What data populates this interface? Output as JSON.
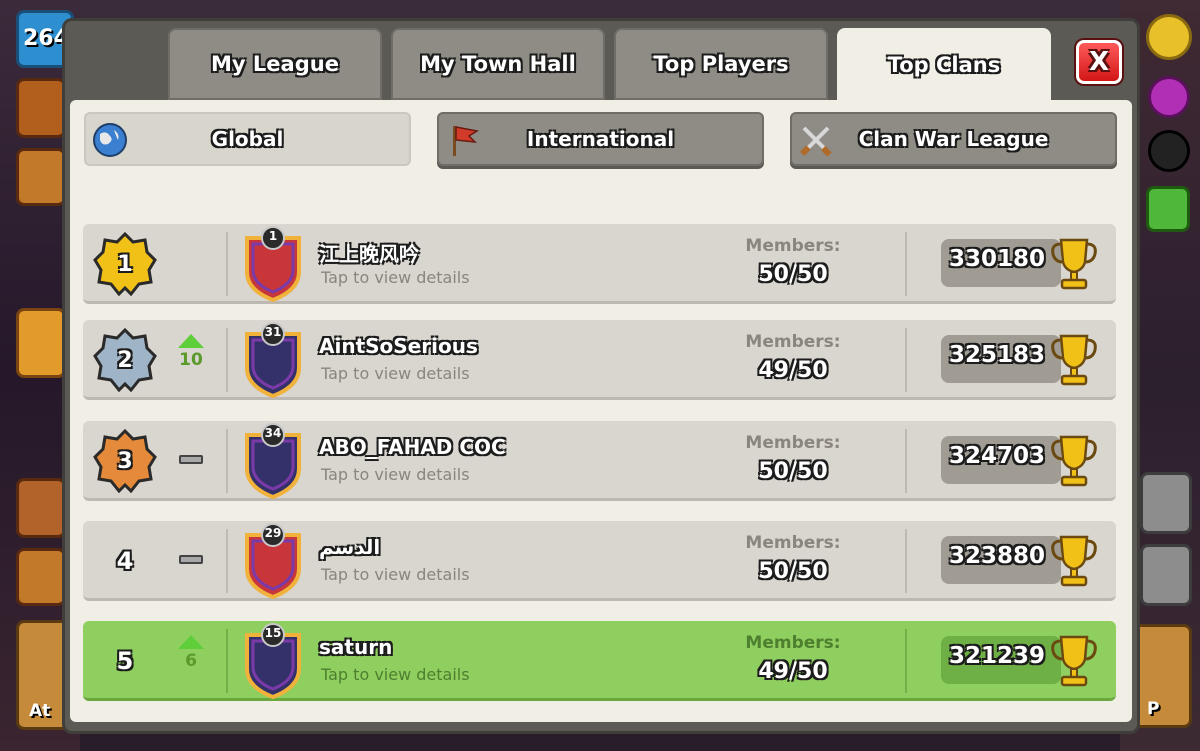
{
  "hud": {
    "level": "264",
    "left_bottom_label": "At",
    "right_bottom_label": "P"
  },
  "tabs": [
    {
      "label": "My League",
      "active": false
    },
    {
      "label": "My Town Hall",
      "active": false
    },
    {
      "label": "Top Players",
      "active": false
    },
    {
      "label": "Top Clans",
      "active": true
    }
  ],
  "close_label": "X",
  "filters": [
    {
      "label": "Global",
      "icon": "globe-icon",
      "selected": true
    },
    {
      "label": "International",
      "icon": "flag-icon",
      "selected": false
    },
    {
      "label": "Clan War League",
      "icon": "crossed-swords-icon",
      "selected": false
    }
  ],
  "members_label": "Members:",
  "tap_label": "Tap to view details",
  "clans": [
    {
      "rank": "1",
      "rank_style": "gold",
      "change": "",
      "change_type": "none",
      "badge_level": "1",
      "badge_color": "#c8363a",
      "name": "江上晚风吟",
      "members": "50/50",
      "trophies": "330180",
      "highlight": false
    },
    {
      "rank": "2",
      "rank_style": "silver",
      "change": "10",
      "change_type": "up",
      "badge_level": "31",
      "badge_color": "#34306a",
      "name": "AintSoSerious",
      "members": "49/50",
      "trophies": "325183",
      "highlight": false
    },
    {
      "rank": "3",
      "rank_style": "bronze",
      "change": "",
      "change_type": "same",
      "badge_level": "34",
      "badge_color": "#34306a",
      "name": "ABO_FAHAD COC",
      "members": "50/50",
      "trophies": "324703",
      "highlight": false
    },
    {
      "rank": "4",
      "rank_style": "plain",
      "change": "",
      "change_type": "same",
      "badge_level": "29",
      "badge_color": "#c8363a",
      "name": "الدسم",
      "members": "50/50",
      "trophies": "323880",
      "highlight": false
    },
    {
      "rank": "5",
      "rank_style": "plain",
      "change": "6",
      "change_type": "up",
      "badge_level": "15",
      "badge_color": "#34306a",
      "name": "saturn",
      "members": "49/50",
      "trophies": "321239",
      "highlight": true
    }
  ],
  "colors": {
    "gold": "#f2c118",
    "silver": "#9fb4c6",
    "bronze": "#e48a3a",
    "highlight_row": "#8fcf5f",
    "up_arrow": "#5ecf3a"
  }
}
